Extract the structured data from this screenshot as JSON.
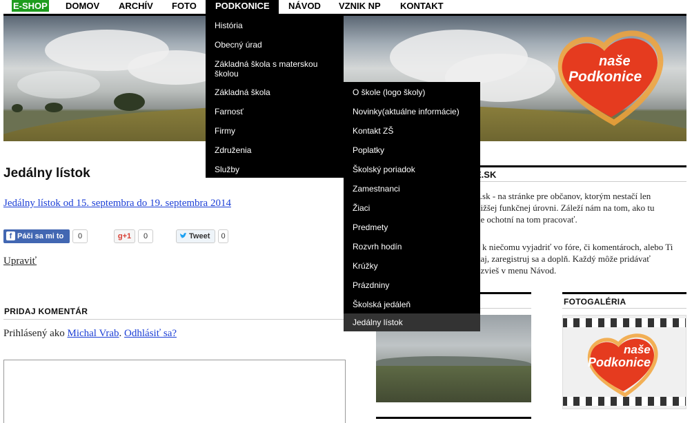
{
  "nav": {
    "eshop": "E-SHOP",
    "items": [
      {
        "label": "DOMOV"
      },
      {
        "label": "ARCHÍV"
      },
      {
        "label": "FOTO"
      },
      {
        "label": "PODKONICE"
      },
      {
        "label": "NÁVOD"
      },
      {
        "label": "VZNIK NP"
      },
      {
        "label": "KONTAKT"
      }
    ],
    "active": "PODKONICE"
  },
  "logo": {
    "line1": "naše",
    "line2": "Podkonice",
    "colors": {
      "heart": "#e53b1f",
      "ring": "#f2a33a"
    }
  },
  "dropdown_podkonice": [
    {
      "label": "História"
    },
    {
      "label": "Obecný úrad"
    },
    {
      "label": "Základná škola s materskou"
    },
    {
      "label": "Základná škola"
    },
    {
      "label": "Farnosť"
    },
    {
      "label": "Firmy"
    },
    {
      "label": "Združenia"
    },
    {
      "label": "Služby"
    }
  ],
  "dropdown_podkonice_wrap": "školou",
  "dropdown_skola": [
    {
      "label": "O škole (logo školy)"
    },
    {
      "label": "Novinky(aktuálne informácie)"
    },
    {
      "label": "Kontakt ZŠ"
    },
    {
      "label": "Poplatky"
    },
    {
      "label": "Školský poriadok"
    },
    {
      "label": "Zamestnanci"
    },
    {
      "label": "Žiaci"
    },
    {
      "label": "Predmety"
    },
    {
      "label": "Rozvrh hodín"
    },
    {
      "label": "Krúžky"
    },
    {
      "label": "Prázdniny"
    },
    {
      "label": "Školská jedáleň"
    },
    {
      "label": "Jedálny lístok"
    }
  ],
  "main": {
    "title": "Jedálny lístok",
    "article_link": "Jedálny lístok  od 15. septembra do 19. septembra 2014",
    "social": {
      "fb_label": "Páči sa mi to",
      "fb_icon": "f",
      "fb_count": "0",
      "gplus_label": "+1",
      "gplus_icon": "g",
      "gplus_count": "0",
      "tweet_label": "Tweet",
      "tweet_count": "0"
    },
    "edit": "Upraviť",
    "comment_head": "PRIDAJ KOMENTÁR",
    "logged_prefix": "Prihlásený ako ",
    "logged_user": "Michal Vrab",
    "logged_sep": ". ",
    "logout": "Odhlásiť sa?"
  },
  "sidebar": {
    "title": "ICE.SK",
    "p1": [
      "e.sk - na stránke pre občanov, ktorým nestačí len",
      "nižšej funkčnej úrovni. Záleží nám na tom, ako tu",
      "ne ochotní na tom pracovať."
    ],
    "p2": [
      "a k niečomu vyjadriť vo fóre, či komentároch, alebo Ti",
      "kaj, zaregistruj sa a doplň. Každý môže pridávať",
      "ozvieš v menu Návod."
    ],
    "gallery_title": "FOTOGALÉRIA"
  }
}
